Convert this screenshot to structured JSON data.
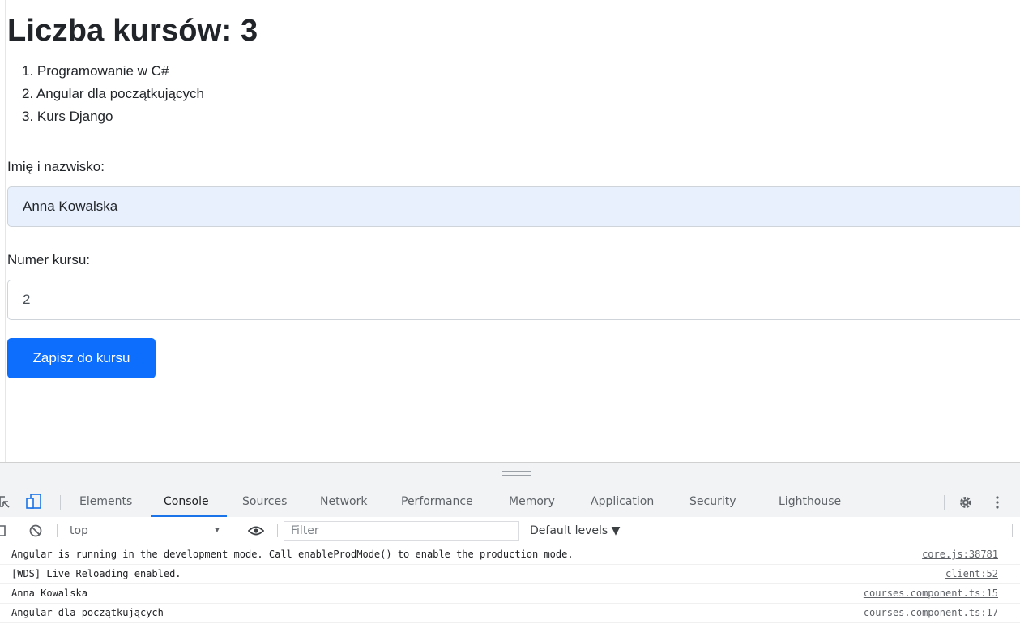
{
  "page": {
    "title": "Liczba kursów: 3",
    "courses": [
      "1. Programowanie w C#",
      "2. Angular dla początkujących",
      "3. Kurs Django"
    ],
    "name_label": "Imię i nazwisko:",
    "name_value": "Anna Kowalska",
    "course_number_label": "Numer kursu:",
    "course_number_value": "2",
    "submit_label": "Zapisz do kursu"
  },
  "devtools": {
    "tabs": [
      "Elements",
      "Console",
      "Sources",
      "Network",
      "Performance",
      "Memory",
      "Application",
      "Security",
      "Lighthouse"
    ],
    "active_tab": "Console",
    "context": "top",
    "filter_placeholder": "Filter",
    "levels": "Default levels ▼",
    "console_rows": [
      {
        "message": "Angular is running in the development mode. Call enableProdMode() to enable the production mode.",
        "source": "core.js:38781"
      },
      {
        "message": "[WDS] Live Reloading enabled.",
        "source": "client:52"
      },
      {
        "message": "Anna Kowalska",
        "source": "courses.component.ts:15"
      },
      {
        "message": "Angular dla początkujących",
        "source": "courses.component.ts:17"
      }
    ]
  },
  "colors": {
    "accent": "#0d6efd",
    "autofill_bg": "#e8f0fe",
    "devtools_active": "#1a73e8"
  }
}
